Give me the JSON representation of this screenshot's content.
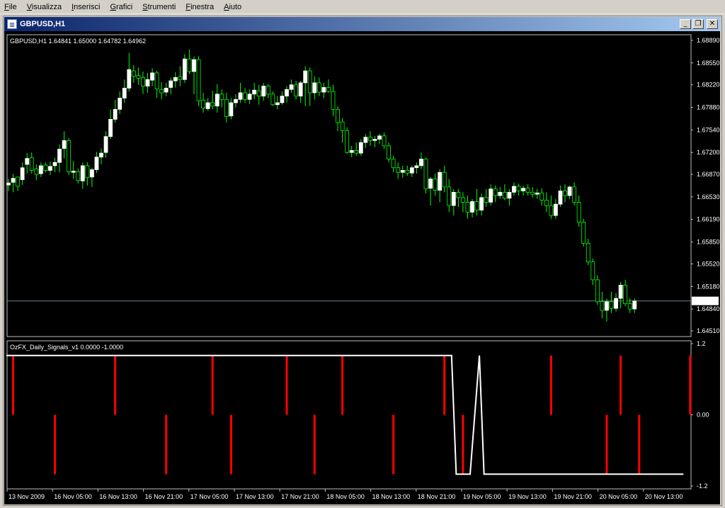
{
  "menu": [
    {
      "acc": "F",
      "rest": "ile"
    },
    {
      "acc": "V",
      "rest": "isualizza"
    },
    {
      "acc": "I",
      "rest": "nserisci"
    },
    {
      "acc": "G",
      "rest": "rafici"
    },
    {
      "acc": "S",
      "rest": "trumenti"
    },
    {
      "acc": "F",
      "rest": "inestra"
    },
    {
      "acc": "A",
      "rest": "iuto"
    }
  ],
  "window": {
    "title": "GBPUSD,H1",
    "minimize_glyph": "_",
    "restore_glyph": "❐",
    "close_glyph": "✕"
  },
  "main_panel": {
    "legend": "GBPUSD,H1  1.64841 1.65000 1.64782 1.64962",
    "price_labels": [
      "1.68890",
      "1.68550",
      "1.68220",
      "1.67880",
      "1.67540",
      "1.67200",
      "1.66870",
      "1.66530",
      "1.66190",
      "1.65850",
      "1.65520",
      "1.65180",
      "1.64840",
      "1.64510"
    ],
    "current_price": "1.64962"
  },
  "indicator_panel": {
    "legend": "OzFX_Daily_Signals_v1 0.0000 -1.0000",
    "labels": [
      "1.2",
      "0.00",
      "-1.2"
    ]
  },
  "time_labels": [
    "13 Nov 2009",
    "16 Nov 05:00",
    "16 Nov 13:00",
    "16 Nov 21:00",
    "17 Nov 05:00",
    "17 Nov 13:00",
    "17 Nov 21:00",
    "18 Nov 05:00",
    "18 Nov 13:00",
    "18 Nov 21:00",
    "19 Nov 05:00",
    "19 Nov 13:00",
    "19 Nov 21:00",
    "20 Nov 05:00",
    "20 Nov 13:00"
  ],
  "chart_data": [
    {
      "type": "candlestick",
      "title": "GBPUSD,H1",
      "ylim": [
        1.6451,
        1.6889
      ],
      "up_color": "#ffffff",
      "down_color": "#000000",
      "wick_color": "#00ff00",
      "last_price": 1.64962,
      "candles": [
        [
          1.6671,
          1.668,
          1.6662,
          1.6674
        ],
        [
          1.6675,
          1.6688,
          1.666,
          1.6681
        ],
        [
          1.6683,
          1.668,
          1.6662,
          1.6669
        ],
        [
          1.6679,
          1.6705,
          1.6671,
          1.6697
        ],
        [
          1.6702,
          1.6719,
          1.6688,
          1.6711
        ],
        [
          1.6712,
          1.672,
          1.6688,
          1.6693
        ],
        [
          1.6695,
          1.6702,
          1.6678,
          1.6687
        ],
        [
          1.6688,
          1.6705,
          1.6683,
          1.67
        ],
        [
          1.6701,
          1.6705,
          1.669,
          1.6693
        ],
        [
          1.6693,
          1.6706,
          1.6686,
          1.6699
        ],
        [
          1.67,
          1.6712,
          1.669,
          1.6705
        ],
        [
          1.6705,
          1.6732,
          1.669,
          1.6725
        ],
        [
          1.6726,
          1.6752,
          1.6711,
          1.6738
        ],
        [
          1.6738,
          1.6742,
          1.6686,
          1.6691
        ],
        [
          1.669,
          1.6707,
          1.668,
          1.6692
        ],
        [
          1.6691,
          1.6696,
          1.6673,
          1.6678
        ],
        [
          1.6677,
          1.6705,
          1.6665,
          1.67
        ],
        [
          1.67,
          1.6705,
          1.667,
          1.6682
        ],
        [
          1.6683,
          1.6697,
          1.6668,
          1.6694
        ],
        [
          1.6694,
          1.6721,
          1.6689,
          1.6713
        ],
        [
          1.6713,
          1.6726,
          1.6702,
          1.6719
        ],
        [
          1.672,
          1.6752,
          1.6712,
          1.6744
        ],
        [
          1.6744,
          1.6785,
          1.674,
          1.677
        ],
        [
          1.677,
          1.6799,
          1.6765,
          1.6785
        ],
        [
          1.6785,
          1.6812,
          1.6778,
          1.6802
        ],
        [
          1.6802,
          1.683,
          1.6795,
          1.6817
        ],
        [
          1.6817,
          1.687,
          1.6812,
          1.6845
        ],
        [
          1.6843,
          1.6852,
          1.6825,
          1.6835
        ],
        [
          1.6836,
          1.6848,
          1.6822,
          1.6832
        ],
        [
          1.6833,
          1.6842,
          1.6808,
          1.682
        ],
        [
          1.682,
          1.684,
          1.681,
          1.683
        ],
        [
          1.6829,
          1.6847,
          1.682,
          1.684
        ],
        [
          1.684,
          1.6843,
          1.6802,
          1.6816
        ],
        [
          1.6815,
          1.6826,
          1.68,
          1.681
        ],
        [
          1.6811,
          1.6825,
          1.6805,
          1.6817
        ],
        [
          1.6818,
          1.6833,
          1.6808,
          1.6828
        ],
        [
          1.6828,
          1.6841,
          1.6818,
          1.6833
        ],
        [
          1.6834,
          1.685,
          1.682,
          1.683
        ],
        [
          1.683,
          1.6868,
          1.6825,
          1.6861
        ],
        [
          1.6861,
          1.6875,
          1.6838,
          1.6842
        ],
        [
          1.6842,
          1.6865,
          1.6808,
          1.686
        ],
        [
          1.686,
          1.6865,
          1.679,
          1.6798
        ],
        [
          1.6799,
          1.681,
          1.678,
          1.6787
        ],
        [
          1.6786,
          1.6802,
          1.6783,
          1.6795
        ],
        [
          1.6795,
          1.6813,
          1.6785,
          1.679
        ],
        [
          1.679,
          1.6823,
          1.678,
          1.6808
        ],
        [
          1.6808,
          1.6815,
          1.6788,
          1.68
        ],
        [
          1.68,
          1.681,
          1.6765,
          1.6774
        ],
        [
          1.6775,
          1.6802,
          1.677,
          1.6795
        ],
        [
          1.6795,
          1.6808,
          1.6788,
          1.68
        ],
        [
          1.68,
          1.6825,
          1.6795,
          1.681
        ],
        [
          1.681,
          1.6817,
          1.6795,
          1.68
        ],
        [
          1.68,
          1.6815,
          1.6793,
          1.6808
        ],
        [
          1.6808,
          1.6825,
          1.68,
          1.6814
        ],
        [
          1.6813,
          1.6822,
          1.6792,
          1.6805
        ],
        [
          1.6805,
          1.6825,
          1.6798,
          1.682
        ],
        [
          1.682,
          1.6823,
          1.6802,
          1.6808
        ],
        [
          1.6808,
          1.6812,
          1.679,
          1.6792
        ],
        [
          1.6792,
          1.6805,
          1.6785,
          1.6795
        ],
        [
          1.6795,
          1.6812,
          1.6792,
          1.6805
        ],
        [
          1.6805,
          1.682,
          1.6795,
          1.6815
        ],
        [
          1.6815,
          1.683,
          1.681,
          1.6822
        ],
        [
          1.6822,
          1.6828,
          1.68,
          1.6805
        ],
        [
          1.6805,
          1.6828,
          1.6795,
          1.6825
        ],
        [
          1.6825,
          1.685,
          1.679,
          1.6843
        ],
        [
          1.6843,
          1.6848,
          1.679,
          1.681
        ],
        [
          1.681,
          1.6835,
          1.68,
          1.6825
        ],
        [
          1.6825,
          1.6833,
          1.6805,
          1.6811
        ],
        [
          1.6811,
          1.6825,
          1.6802,
          1.6818
        ],
        [
          1.6818,
          1.683,
          1.681,
          1.6812
        ],
        [
          1.6812,
          1.6822,
          1.6775,
          1.6785
        ],
        [
          1.6785,
          1.679,
          1.6752,
          1.6765
        ],
        [
          1.6766,
          1.6772,
          1.6735,
          1.6753
        ],
        [
          1.6753,
          1.6758,
          1.6718,
          1.672
        ],
        [
          1.672,
          1.673,
          1.6713,
          1.6723
        ],
        [
          1.6723,
          1.6735,
          1.6715,
          1.6719
        ],
        [
          1.6719,
          1.674,
          1.6715,
          1.6735
        ],
        [
          1.6735,
          1.6748,
          1.6727,
          1.6743
        ],
        [
          1.6743,
          1.6752,
          1.673,
          1.6738
        ],
        [
          1.6738,
          1.6745,
          1.6728,
          1.674
        ],
        [
          1.674,
          1.6748,
          1.6733,
          1.6745
        ],
        [
          1.6745,
          1.675,
          1.6725,
          1.673
        ],
        [
          1.673,
          1.6735,
          1.6705,
          1.671
        ],
        [
          1.671,
          1.6715,
          1.669,
          1.6697
        ],
        [
          1.6697,
          1.6705,
          1.668,
          1.669
        ],
        [
          1.669,
          1.67,
          1.6682,
          1.6693
        ],
        [
          1.6693,
          1.67,
          1.6685,
          1.6689
        ],
        [
          1.6689,
          1.67,
          1.6683,
          1.6697
        ],
        [
          1.6697,
          1.6705,
          1.6688,
          1.67
        ],
        [
          1.67,
          1.672,
          1.6695,
          1.671
        ],
        [
          1.671,
          1.6712,
          1.6658,
          1.6665
        ],
        [
          1.6666,
          1.6683,
          1.664,
          1.668
        ],
        [
          1.668,
          1.6688,
          1.6655,
          1.6663
        ],
        [
          1.6663,
          1.6695,
          1.6645,
          1.669
        ],
        [
          1.669,
          1.67,
          1.666,
          1.6668
        ],
        [
          1.6668,
          1.668,
          1.663,
          1.664
        ],
        [
          1.664,
          1.6665,
          1.6625,
          1.666
        ],
        [
          1.666,
          1.6665,
          1.6638,
          1.6652
        ],
        [
          1.6652,
          1.666,
          1.663,
          1.6645
        ],
        [
          1.6645,
          1.6655,
          1.662,
          1.663
        ],
        [
          1.663,
          1.665,
          1.6622,
          1.6646
        ],
        [
          1.6646,
          1.6665,
          1.6625,
          1.6633
        ],
        [
          1.6633,
          1.6658,
          1.6625,
          1.6652
        ],
        [
          1.6652,
          1.6665,
          1.6638,
          1.6645
        ],
        [
          1.6645,
          1.6672,
          1.664,
          1.6665
        ],
        [
          1.6665,
          1.667,
          1.6645,
          1.6655
        ],
        [
          1.6655,
          1.6668,
          1.665,
          1.666
        ],
        [
          1.666,
          1.6672,
          1.6648,
          1.6651
        ],
        [
          1.6651,
          1.6665,
          1.664,
          1.666
        ],
        [
          1.666,
          1.6675,
          1.6655,
          1.6669
        ],
        [
          1.6669,
          1.6673,
          1.6655,
          1.6662
        ],
        [
          1.6662,
          1.667,
          1.6655,
          1.6666
        ],
        [
          1.6666,
          1.6672,
          1.6655,
          1.666
        ],
        [
          1.666,
          1.6668,
          1.6652,
          1.6657
        ],
        [
          1.6657,
          1.6665,
          1.665,
          1.6659
        ],
        [
          1.6659,
          1.6666,
          1.664,
          1.6648
        ],
        [
          1.6648,
          1.666,
          1.663,
          1.664
        ],
        [
          1.664,
          1.6655,
          1.662,
          1.6625
        ],
        [
          1.6625,
          1.665,
          1.662,
          1.6642
        ],
        [
          1.6642,
          1.667,
          1.6638,
          1.6662
        ],
        [
          1.6662,
          1.6672,
          1.6645,
          1.6655
        ],
        [
          1.6655,
          1.667,
          1.665,
          1.6668
        ],
        [
          1.6668,
          1.6675,
          1.664,
          1.6645
        ],
        [
          1.6645,
          1.6655,
          1.6608,
          1.6615
        ],
        [
          1.6615,
          1.662,
          1.6578,
          1.6583
        ],
        [
          1.6583,
          1.659,
          1.655,
          1.6555
        ],
        [
          1.6555,
          1.656,
          1.652,
          1.6528
        ],
        [
          1.6528,
          1.6535,
          1.649,
          1.6495
        ],
        [
          1.6495,
          1.651,
          1.647,
          1.6482
        ],
        [
          1.6482,
          1.65,
          1.6465,
          1.6495
        ],
        [
          1.6495,
          1.651,
          1.6478,
          1.6485
        ],
        [
          1.6485,
          1.6508,
          1.648,
          1.65
        ],
        [
          1.65,
          1.6525,
          1.6485,
          1.652
        ],
        [
          1.652,
          1.6528,
          1.6488,
          1.6492
        ],
        [
          1.6492,
          1.65,
          1.6478,
          1.6484
        ],
        [
          1.6484,
          1.65,
          1.6478,
          1.6496
        ]
      ]
    },
    {
      "type": "line",
      "title": "OzFX_Daily_Signals_v1",
      "ylim": [
        -1.2,
        1.2
      ],
      "values_shown": [
        0.0,
        -1.0
      ],
      "line_color": "#ffffff",
      "bar_color": "#ff0000",
      "line_points": [
        [
          0,
          1
        ],
        [
          96,
          1
        ],
        [
          97,
          -1
        ],
        [
          100,
          -1
        ],
        [
          102,
          1
        ],
        [
          103,
          -1
        ],
        [
          146,
          -1
        ]
      ],
      "signal_bars": [
        {
          "x": 1,
          "value": 1
        },
        {
          "x": 10,
          "value": -1
        },
        {
          "x": 23,
          "value": 1
        },
        {
          "x": 34,
          "value": -1
        },
        {
          "x": 44,
          "value": 1
        },
        {
          "x": 48,
          "value": -1
        },
        {
          "x": 60,
          "value": 1
        },
        {
          "x": 66,
          "value": -1
        },
        {
          "x": 72,
          "value": 1
        },
        {
          "x": 83,
          "value": -1
        },
        {
          "x": 94,
          "value": 1
        },
        {
          "x": 98,
          "value": -1
        },
        {
          "x": 117,
          "value": 1
        },
        {
          "x": 129,
          "value": -1
        },
        {
          "x": 132,
          "value": 1
        },
        {
          "x": 136,
          "value": -1
        },
        {
          "x": 147,
          "value": 1
        }
      ]
    }
  ]
}
